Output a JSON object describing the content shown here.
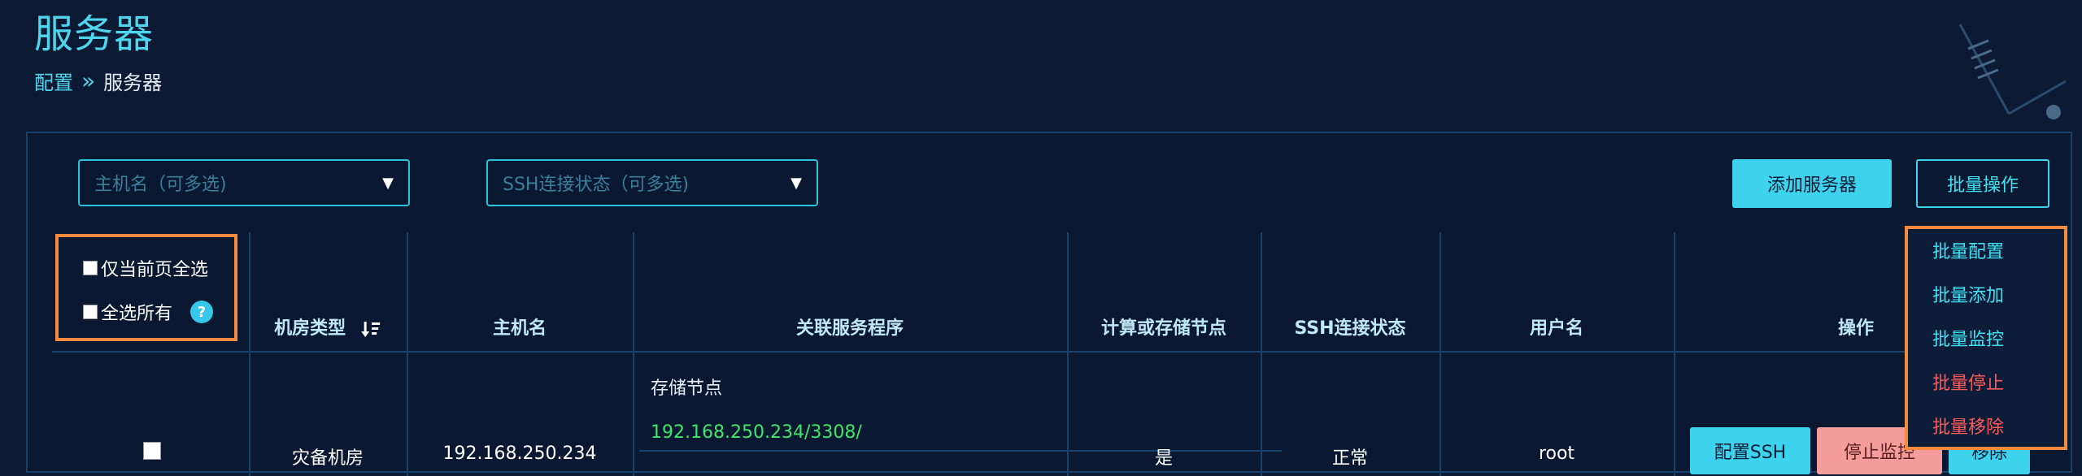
{
  "page": {
    "title": "服务器",
    "breadcrumb": {
      "parent": "配置",
      "separator": "»",
      "current": "服务器"
    }
  },
  "filters": {
    "host_placeholder": "主机名（可多选)",
    "ssh_placeholder": "SSH连接状态（可多选)"
  },
  "toolbar": {
    "add_server": "添加服务器",
    "batch_ops": "批量操作"
  },
  "selection": {
    "current_page": "仅当前页全选",
    "select_all": "全选所有",
    "help": "?"
  },
  "table": {
    "headers": [
      "机房类型",
      "主机名",
      "关联服务程序",
      "计算或存储节点",
      "SSH连接状态",
      "用户名",
      "操作"
    ],
    "rows": [
      {
        "room_type": "灾备机房",
        "hostname": "192.168.250.234",
        "service_label": "存储节点",
        "service_addr": "192.168.250.234/3308/",
        "compute_or_storage": "是",
        "ssh_status": "正常",
        "username": "root",
        "actions": {
          "config": "配置SSH",
          "stop": "停止监控",
          "remove": "移除"
        }
      }
    ]
  },
  "batch_menu": {
    "items": [
      "批量配置",
      "批量添加",
      "批量监控",
      "批量停止",
      "批量移除"
    ]
  },
  "colors": {
    "accent": "#3ed3ec",
    "highlight": "#f58a3d",
    "danger": "#ff5a5a",
    "success": "#3ee66a",
    "background": "#0c1a33"
  }
}
